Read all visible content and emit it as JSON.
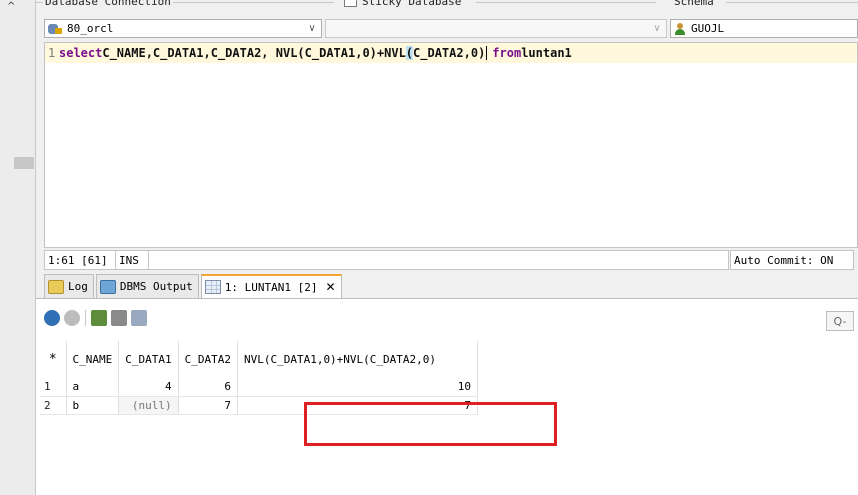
{
  "connection_bar": {
    "db_connection_label": "Database Connection",
    "sticky_label": "Sticky Database",
    "schema_label": "Schema",
    "connection_value": "80_orcl",
    "database_value": "",
    "schema_value": "GUOJL"
  },
  "editor": {
    "line_number": "1",
    "sql_kw_select": "select",
    "sql_part1": " C_NAME,C_DATA1,C_DATA2, NVL(C_DATA1,0)+NVL",
    "sql_paren_open": "(",
    "sql_part2": "C_DATA2,0",
    "sql_paren_close": ")",
    "sql_kw_from": "from",
    "sql_table": " luntan1"
  },
  "status": {
    "position": "1:61",
    "offset": "[61]",
    "mode": "INS",
    "auto_commit": "Auto Commit: ON"
  },
  "tabs": [
    {
      "label": "Log",
      "icon": "log-icon"
    },
    {
      "label": "DBMS Output",
      "icon": "dbms-output-icon"
    },
    {
      "label": "1: LUNTAN1 [2]",
      "icon": "grid-icon",
      "close": "✕"
    }
  ],
  "filter_label": "Q-",
  "results": {
    "columns": [
      "*",
      "C_NAME",
      "C_DATA1",
      "C_DATA2",
      "NVL(C_DATA1,0)+NVL(C_DATA2,0)"
    ],
    "rows": [
      {
        "rn": "1",
        "c_name": "a",
        "c_data1": "4",
        "c_data2": "6",
        "expr": "10"
      },
      {
        "rn": "2",
        "c_name": "b",
        "c_data1": "(null)",
        "c_data2": "7",
        "expr": "7"
      }
    ]
  },
  "colors": {
    "highlight_box": "#e02020",
    "editor_line_bg": "#fff8dc",
    "keyword": "#7a0f8a"
  }
}
